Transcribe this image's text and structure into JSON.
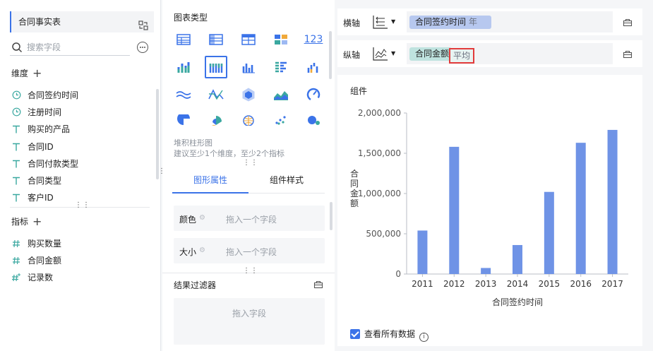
{
  "left": {
    "dataset_title": "合同事实表",
    "search_placeholder": "搜索字段",
    "dimensions_label": "维度",
    "dimensions": [
      {
        "label": "合同签约时间",
        "icon": "clock-icon"
      },
      {
        "label": "注册时间",
        "icon": "clock-icon"
      },
      {
        "label": "购买的产品",
        "icon": "text-type-icon"
      },
      {
        "label": "合同ID",
        "icon": "text-type-icon"
      },
      {
        "label": "合同付款类型",
        "icon": "text-type-icon"
      },
      {
        "label": "合同类型",
        "icon": "text-type-icon"
      },
      {
        "label": "客户ID",
        "icon": "text-type-icon"
      }
    ],
    "measures_label": "指标",
    "measures": [
      {
        "label": "购买数量",
        "icon": "number-type-icon"
      },
      {
        "label": "合同金额",
        "icon": "number-type-icon"
      },
      {
        "label": "记录数",
        "icon": "calc-number-icon"
      }
    ],
    "plus_glyph": "+",
    "drag_glyph": "⋮⋮"
  },
  "middle": {
    "chart_types_label": "图表类型",
    "selected_type_name": "堆积柱形图",
    "selected_type_hint": "建议至少1个维度，至少2个指标",
    "tabs": [
      "图形属性",
      "组件样式"
    ],
    "props": [
      {
        "label": "颜色",
        "placeholder": "拖入一个字段"
      },
      {
        "label": "大小",
        "placeholder": "拖入一个字段"
      }
    ],
    "gear_glyph": "⚙",
    "filter_label": "结果过滤器",
    "filter_placeholder": "拖入字段",
    "number_icon_text": "123"
  },
  "right": {
    "x_axis_label": "横轴",
    "x_field": "合同签约时间",
    "x_field_granularity": "年",
    "y_axis_label": "纵轴",
    "y_field": "合同金额",
    "y_aggregation": "平均",
    "caret": "▼",
    "card_title": "组件",
    "show_all_data_label": "查看所有数据",
    "info_glyph": "i"
  },
  "chart_data": {
    "type": "bar",
    "categories": [
      "2011",
      "2012",
      "2013",
      "2014",
      "2015",
      "2016",
      "2017"
    ],
    "values": [
      540000,
      1580000,
      75000,
      360000,
      1020000,
      1630000,
      1790000
    ],
    "xlabel": "合同签约时间",
    "ylabel": "合同金额",
    "ylim": [
      0,
      2000000
    ],
    "yticks": [
      0,
      500000,
      1000000,
      1500000,
      2000000
    ],
    "ytick_labels": [
      "0",
      "500,000",
      "1,000,000",
      "1,500,000",
      "2,000,000"
    ],
    "bar_color": "#6f93e6",
    "grid": false,
    "legend": "none"
  }
}
